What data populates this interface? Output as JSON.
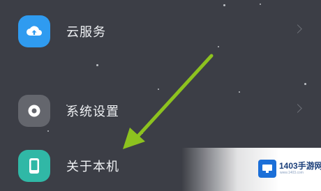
{
  "settings": {
    "items": [
      {
        "label": "云服务",
        "icon": "cloud-upload-icon",
        "icon_color": "#2f9bf0"
      },
      {
        "label": "系统设置",
        "icon": "gear-icon",
        "icon_color": "#64666d"
      },
      {
        "label": "关于本机",
        "icon": "phone-icon",
        "icon_color": "#30b8a6"
      }
    ]
  },
  "annotation": {
    "arrow_color": "#8dc21f"
  },
  "watermark": {
    "site_name": "1403手游网",
    "site_url": "www.1403.com"
  }
}
